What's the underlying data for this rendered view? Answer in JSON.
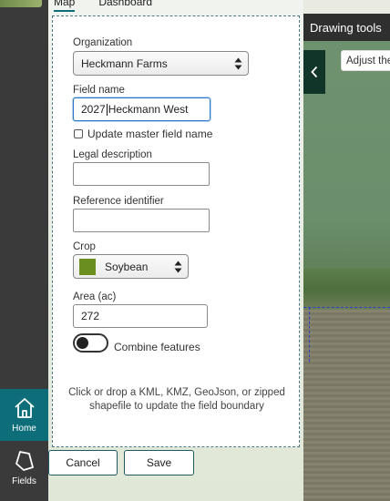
{
  "tabs": [
    {
      "label": "Map"
    },
    {
      "label": "Dashboard"
    }
  ],
  "nav": {
    "home_label": "Home",
    "fields_label": "Fields"
  },
  "form": {
    "organization": {
      "label": "Organization",
      "value": "Heckmann Farms"
    },
    "field_name": {
      "label": "Field name",
      "value_before_caret": "2027",
      "value_after_caret": "Heckmann West"
    },
    "update_master": {
      "label": "Update master field name",
      "checked": false
    },
    "legal_description": {
      "label": "Legal description",
      "value": ""
    },
    "reference_identifier": {
      "label": "Reference identifier",
      "value": ""
    },
    "crop": {
      "label": "Crop",
      "value": "Soybean",
      "color": "#6b8f1f"
    },
    "area": {
      "label": "Area (ac)",
      "value": "272"
    },
    "combine_features": {
      "label": "Combine features",
      "on": false
    },
    "drop_hint": "Click or drop a KML, KMZ, GeoJson, or zipped shapefile to update the field boundary"
  },
  "buttons": {
    "cancel": "Cancel",
    "save": "Save"
  },
  "map": {
    "drawing_tools_title": "Drawing tools",
    "tooltip": "Adjust the",
    "boundary_color": "#2b3fd0"
  },
  "colors": {
    "accent": "#0d6e7a",
    "rail": "#3a3a3a",
    "focus_border": "#2a79c9"
  }
}
